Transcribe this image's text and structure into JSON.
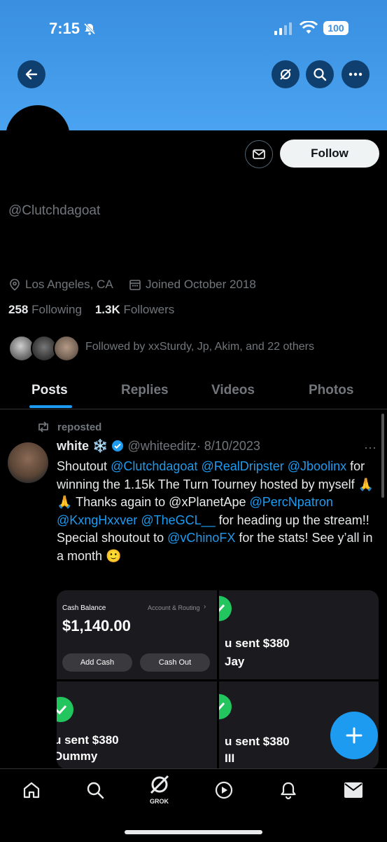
{
  "status_bar": {
    "time": "7:15",
    "battery": "100"
  },
  "profile": {
    "handle": "@Clutchdagoat",
    "location": "Los Angeles, CA",
    "joined": "Joined October 2018",
    "following_count": "258",
    "following_label": "Following",
    "followers_count": "1.3K",
    "followers_label": "Followers",
    "followed_by": "Followed by xxSturdy, Jp, Akim, and 22 others",
    "follow_label": "Follow"
  },
  "tabs": [
    {
      "label": "Posts",
      "active": true
    },
    {
      "label": "Replies",
      "active": false
    },
    {
      "label": "Videos",
      "active": false
    },
    {
      "label": "Photos",
      "active": false
    }
  ],
  "post": {
    "repost_label": "reposted",
    "author_name": "white",
    "author_emoji": "❄️",
    "author_handle": "@whiteeditz",
    "date": "· 8/10/2023",
    "text_parts": {
      "p1": "Shoutout ",
      "m1": "@Clutchdagoat",
      "m2": "@RealDripster",
      "m3": "@Jboolinx",
      "p2": " for winning the 1.15k The Turn Tourney hosted by myself 🙏🙏 Thanks again to @xPlanetApe ",
      "m4": "@PercNpatron",
      "m5": "@KxngHxxver",
      "m6": "@TheGCL__",
      "p3": " for heading up the stream!! Special shoutout to ",
      "m7": "@vChinoFX",
      "p4": " for the stats! See y’all in a month 🙂"
    },
    "media": {
      "cash_balance_label": "Cash Balance",
      "account_routing": "Account & Routing",
      "amount": "$1,140.00",
      "add_cash": "Add Cash",
      "cash_out": "Cash Out",
      "sent_1": "u sent $380",
      "to_1": "Jay",
      "sent_2": "u sent $380",
      "to_2": "Dummy",
      "sent_3": "u sent $380",
      "to_3": "III"
    }
  },
  "bottom_nav": {
    "grok_label": "GROK"
  },
  "colors": {
    "accent": "#1d9bf0",
    "banner": "#4aa3f0",
    "background": "#000000",
    "check": "#22c55e"
  }
}
